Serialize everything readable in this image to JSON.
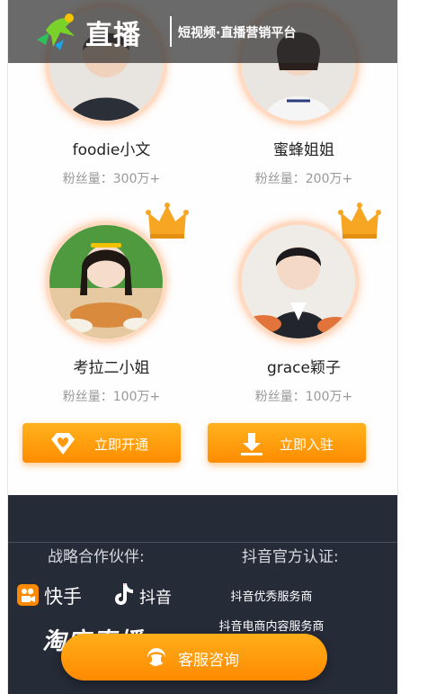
{
  "header": {
    "logo_title": "直播",
    "subtitle": "短视频·直播营销平台"
  },
  "influencers": [
    {
      "name": "foodie小文",
      "fans": "粉丝量：300万+",
      "icon": "avatar"
    },
    {
      "name": "蜜蜂姐姐",
      "fans": "粉丝量：200万+",
      "icon": "avatar"
    },
    {
      "name": "考拉二小姐",
      "fans": "粉丝量：100万+",
      "icon": "avatar"
    },
    {
      "name": "grace颖子",
      "fans": "粉丝量：100万+",
      "icon": "avatar"
    }
  ],
  "actions": {
    "open_label": "立即开通",
    "open_icon": "diamond-heart-icon",
    "join_label": "立即入驻",
    "join_icon": "download-icon"
  },
  "footer": {
    "partners_title": "战略合作伙伴:",
    "certification_title": "抖音官方认证:",
    "partners": [
      "快手",
      "抖音",
      "淘宝直播"
    ],
    "certifications": [
      "抖音优秀服务商",
      "抖音电商内容服务商"
    ]
  },
  "service_button": {
    "label": "客服咨询",
    "icon": "headset-icon"
  },
  "colors": {
    "accent_orange": "#ff9500",
    "footer_bg": "#262b38",
    "header_overlay": "#303030"
  }
}
